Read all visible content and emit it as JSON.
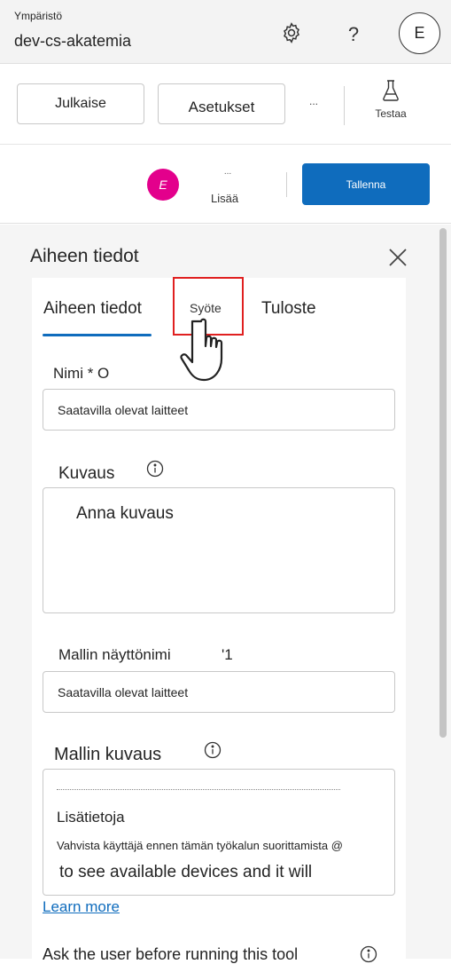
{
  "header": {
    "environment_label": "Ympäristö",
    "environment_name": "dev-cs-akatemia",
    "help_glyph": "?",
    "user_initial": "E"
  },
  "toolbar": {
    "publish_label": "Julkaise",
    "settings_label": "Asetukset",
    "more_label": "...",
    "test_label": "Testaa"
  },
  "actionbar": {
    "avatar_initial": "E",
    "more_dots": "...",
    "more_label": "Lisää",
    "save_label": "Tallenna"
  },
  "panel": {
    "title": "Aiheen tiedot",
    "tabs": [
      {
        "label": "Aiheen tiedot",
        "selected": true
      },
      {
        "label": "Syöte",
        "selected": false
      },
      {
        "label": "Tuloste",
        "selected": false
      }
    ],
    "name_label": "Nimi * O",
    "name_value": "Saatavilla olevat laitteet",
    "description_label": "Kuvaus",
    "description_placeholder": "Anna kuvaus",
    "model_display_name_label": "Mallin näyttönimi",
    "model_display_name_suffix": "'1",
    "model_display_name_value": "Saatavilla olevat laitteet",
    "model_description_label": "Mallin kuvaus",
    "model_description_lines": [
      "Lisätietoja",
      "Vahvista käyttäjä ennen tämän työkalun suorittamista @",
      "to see available devices and it will"
    ],
    "learn_more": "Learn more",
    "ask_user_label": "Ask the user before running this tool"
  },
  "colors": {
    "accent": "#0f6cbd",
    "avatar_pink": "#e3008c",
    "highlight": "#e02020"
  }
}
